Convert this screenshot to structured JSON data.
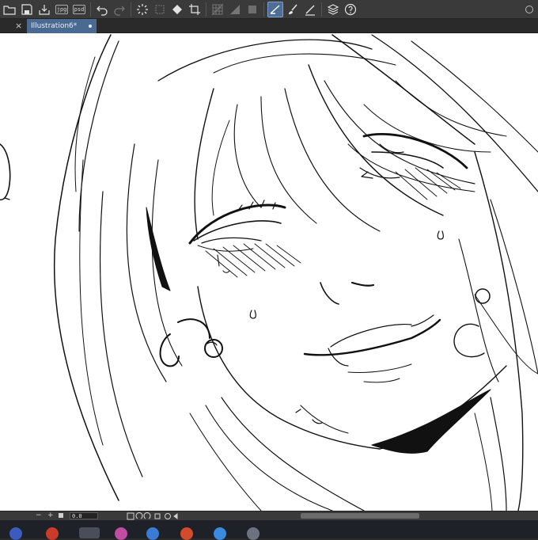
{
  "toolbar": {
    "buttons": [
      {
        "name": "open-folder-icon"
      },
      {
        "name": "save-icon"
      },
      {
        "name": "export-icon"
      },
      {
        "name": "jpg-export-button",
        "label": "jpg"
      },
      {
        "name": "psd-export-button",
        "label": "psd"
      },
      {
        "name": "undo-icon"
      },
      {
        "name": "redo-icon"
      },
      {
        "name": "loading-spinner-icon"
      },
      {
        "name": "transform-icon"
      },
      {
        "name": "fill-bucket-icon"
      },
      {
        "name": "crop-icon"
      },
      {
        "name": "grid-off-icon"
      },
      {
        "name": "ruler-triangle-icon"
      },
      {
        "name": "square-outline-icon"
      },
      {
        "name": "vector-pen-icon"
      },
      {
        "name": "brush-icon"
      },
      {
        "name": "stabilizer-pen-icon"
      },
      {
        "name": "layer-stack-icon"
      },
      {
        "name": "help-icon"
      }
    ]
  },
  "tabs": [
    {
      "label": "Illustration6*",
      "active": true
    }
  ],
  "tab_close_label": "×",
  "status": {
    "minus": "−",
    "plus": "+",
    "zoom_value": "0.0"
  },
  "colors": {
    "toolbar_bg": "#3a3a3a",
    "tab_active": "#4b6a92",
    "canvas_bg": "#ffffff",
    "ink": "#111111",
    "taskbar_bg": "#1f2129"
  }
}
